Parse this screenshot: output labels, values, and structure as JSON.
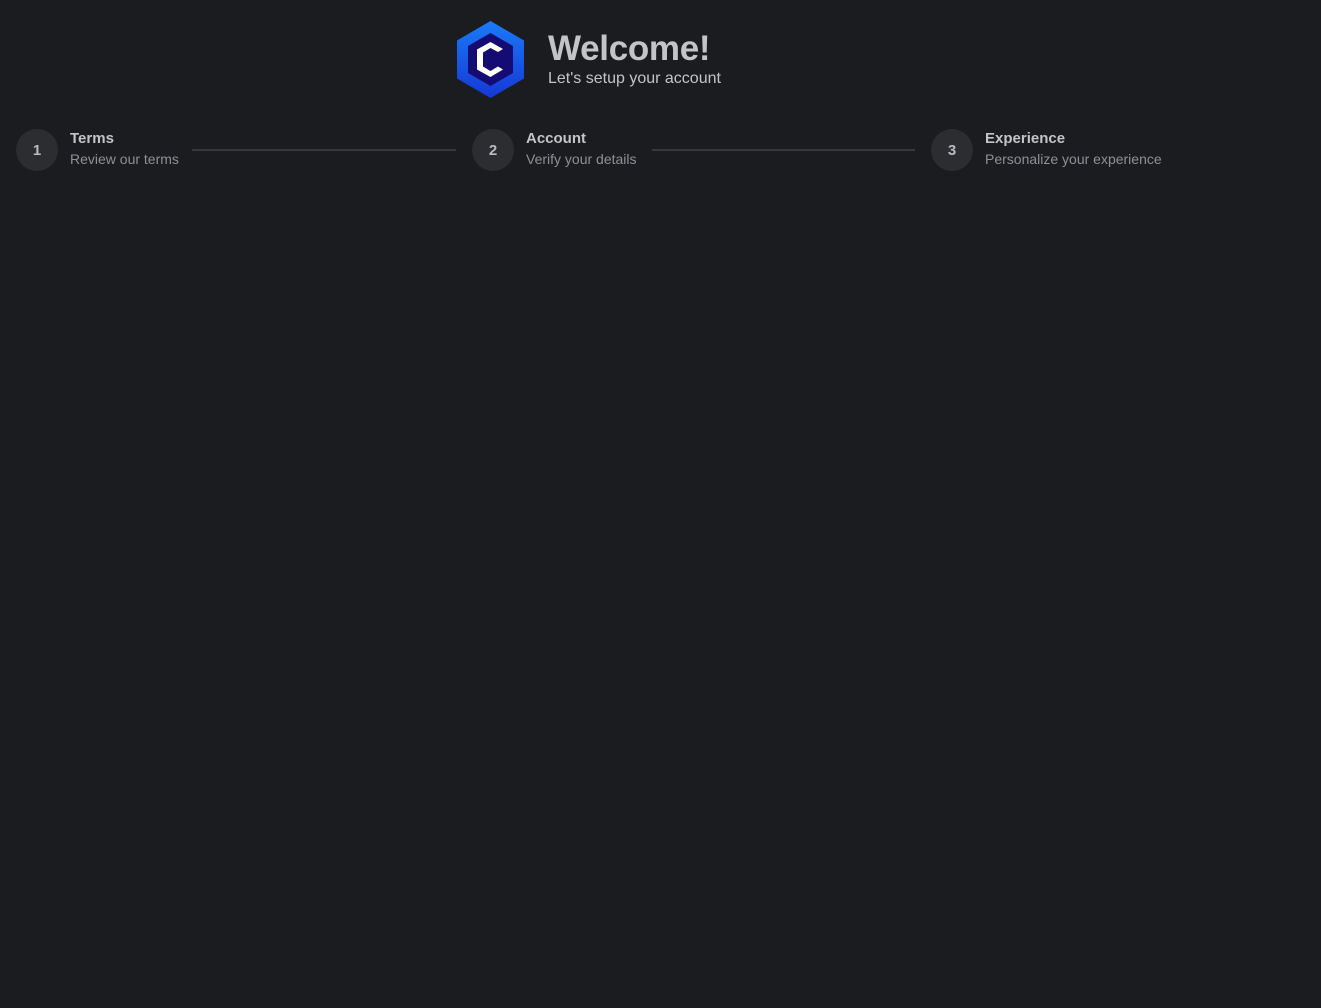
{
  "header": {
    "title": "Welcome!",
    "subtitle": "Let's setup your account",
    "logo_icon": "hexagon-c-logo-icon"
  },
  "stepper": {
    "steps": [
      {
        "number": "1",
        "title": "Terms",
        "description": "Review our terms"
      },
      {
        "number": "2",
        "title": "Account",
        "description": "Verify your details"
      },
      {
        "number": "3",
        "title": "Experience",
        "description": "Personalize your experience"
      }
    ]
  },
  "colors": {
    "background": "#1b1c1f",
    "logo_blue": "#1769f5",
    "logo_dark": "#0f0a6e",
    "step_circle": "#2c2d31",
    "connector": "#38393d"
  }
}
